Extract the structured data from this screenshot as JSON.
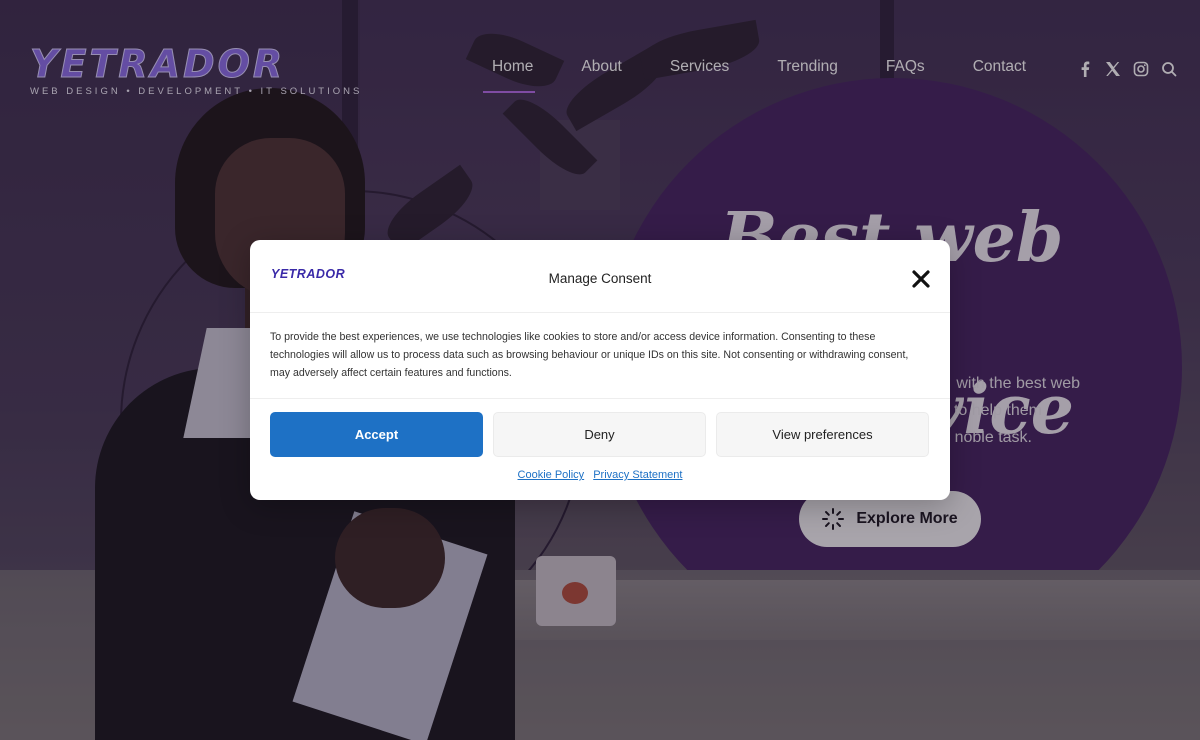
{
  "header": {
    "logo": {
      "word": "YETRADOR",
      "tagline": "WEB DESIGN  •  DEVELOPMENT  •  IT SOLUTIONS"
    },
    "nav": [
      {
        "label": "Home",
        "active": true
      },
      {
        "label": "About"
      },
      {
        "label": "Services"
      },
      {
        "label": "Trending"
      },
      {
        "label": "FAQs"
      },
      {
        "label": "Contact"
      }
    ],
    "socials": [
      "facebook-icon",
      "x-icon",
      "instagram-icon",
      "search-icon"
    ]
  },
  "hero": {
    "title_line1": "Best web &",
    "title_line2": "vice",
    "description_line1": "with the best web",
    "description_line2": "to help them",
    "description_line3": "noble task.",
    "button_label": "Explore More",
    "circle_color": "#43215f"
  },
  "consent": {
    "logo": "YETRADOR",
    "title": "Manage Consent",
    "body": "To provide the best experiences, we use technologies like cookies to store and/or access device information. Consenting to these technologies will allow us to process data such as browsing behaviour or unique IDs on this site. Not consenting or withdrawing consent, may adversely affect certain features and functions.",
    "accept_label": "Accept",
    "deny_label": "Deny",
    "preferences_label": "View preferences",
    "links": [
      "Cookie Policy",
      "Privacy Statement"
    ],
    "accent_color": "#1e71c5"
  }
}
